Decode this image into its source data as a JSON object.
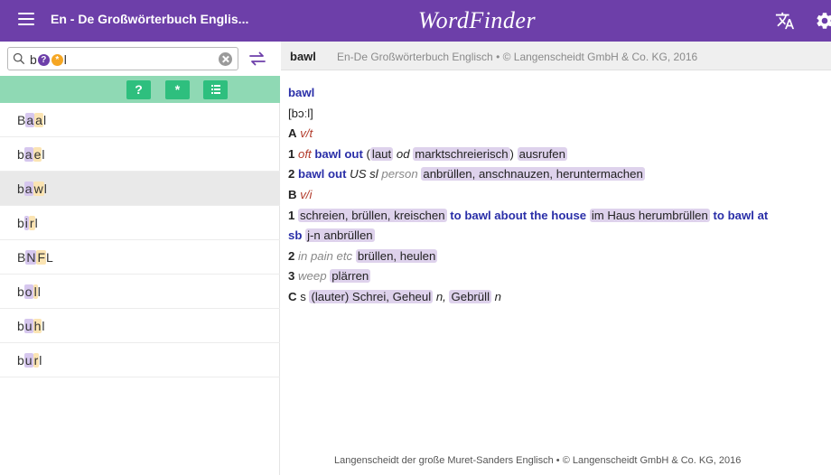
{
  "header": {
    "dictionary_title": "En - De Großwörterbuch Englis...",
    "app_title": "WordFinder",
    "background_color": "#6d3fa9"
  },
  "search": {
    "prefix": "b",
    "wildcard_1": "?",
    "wildcard_2": "*",
    "suffix": "l"
  },
  "filter_buttons": {
    "question": "?",
    "star": "*",
    "list_icon": "list-icon"
  },
  "results": [
    {
      "p1": "B",
      "h1": "a",
      "h2": "a",
      "p2": "l"
    },
    {
      "p1": "b",
      "h1": "a",
      "h2": "e",
      "p2": "l"
    },
    {
      "p1": "b",
      "h1": "a",
      "h2": "w",
      "p2": "l"
    },
    {
      "p1": "b",
      "h1": "i",
      "h2": "r",
      "p2": "l"
    },
    {
      "p1": "B",
      "h1": "N",
      "h2": "F",
      "p2": "L"
    },
    {
      "p1": "b",
      "h1": "o",
      "h2": "l",
      "p2": "l"
    },
    {
      "p1": "b",
      "h1": "u",
      "h2": "h",
      "p2": "l"
    },
    {
      "p1": "b",
      "h1": "u",
      "h2": "r",
      "p2": "l"
    }
  ],
  "selected_index": 2,
  "entry_header": {
    "headword": "bawl",
    "source": "En-De Großwörterbuch Englisch • © Langenscheidt GmbH & Co. KG, 2016"
  },
  "entry": {
    "headword": "bawl",
    "pronunciation": "[bɔːl]",
    "sense_a": {
      "letter": "A",
      "pos": "v/t"
    },
    "a1": {
      "num": "1",
      "label": "oft",
      "en": "bawl out",
      "open": "(",
      "t1": "laut",
      "od": "od",
      "t2": "marktschreierisch",
      "close": ")",
      "t3": "ausrufen"
    },
    "a2": {
      "num": "2",
      "en": "bawl out",
      "label_us": "US",
      "label_sl": "sl",
      "gram": "person",
      "t1": "anbrüllen, anschnauzen, heruntermachen"
    },
    "sense_b": {
      "letter": "B",
      "pos": "v/i"
    },
    "b1": {
      "num": "1",
      "t1": "schreien, brüllen, kreischen",
      "en1": "to bawl about the house",
      "t2": "im Haus herumbrüllen",
      "en2": "to bawl at",
      "en3": "sb",
      "t3": "j-n anbrüllen"
    },
    "b2": {
      "num": "2",
      "gram": "in pain etc",
      "t1": "brüllen, heulen"
    },
    "b3": {
      "num": "3",
      "gram": "weep",
      "t1": "plärren"
    },
    "sense_c": {
      "letter": "C",
      "pos": "s",
      "t1": "(lauter) Schrei, Geheul",
      "g1": "n,",
      "t2": "Gebrüll",
      "g2": "n"
    }
  },
  "footer": "Langenscheidt der große Muret-Sanders Englisch • © Langenscheidt GmbH & Co. KG, 2016"
}
